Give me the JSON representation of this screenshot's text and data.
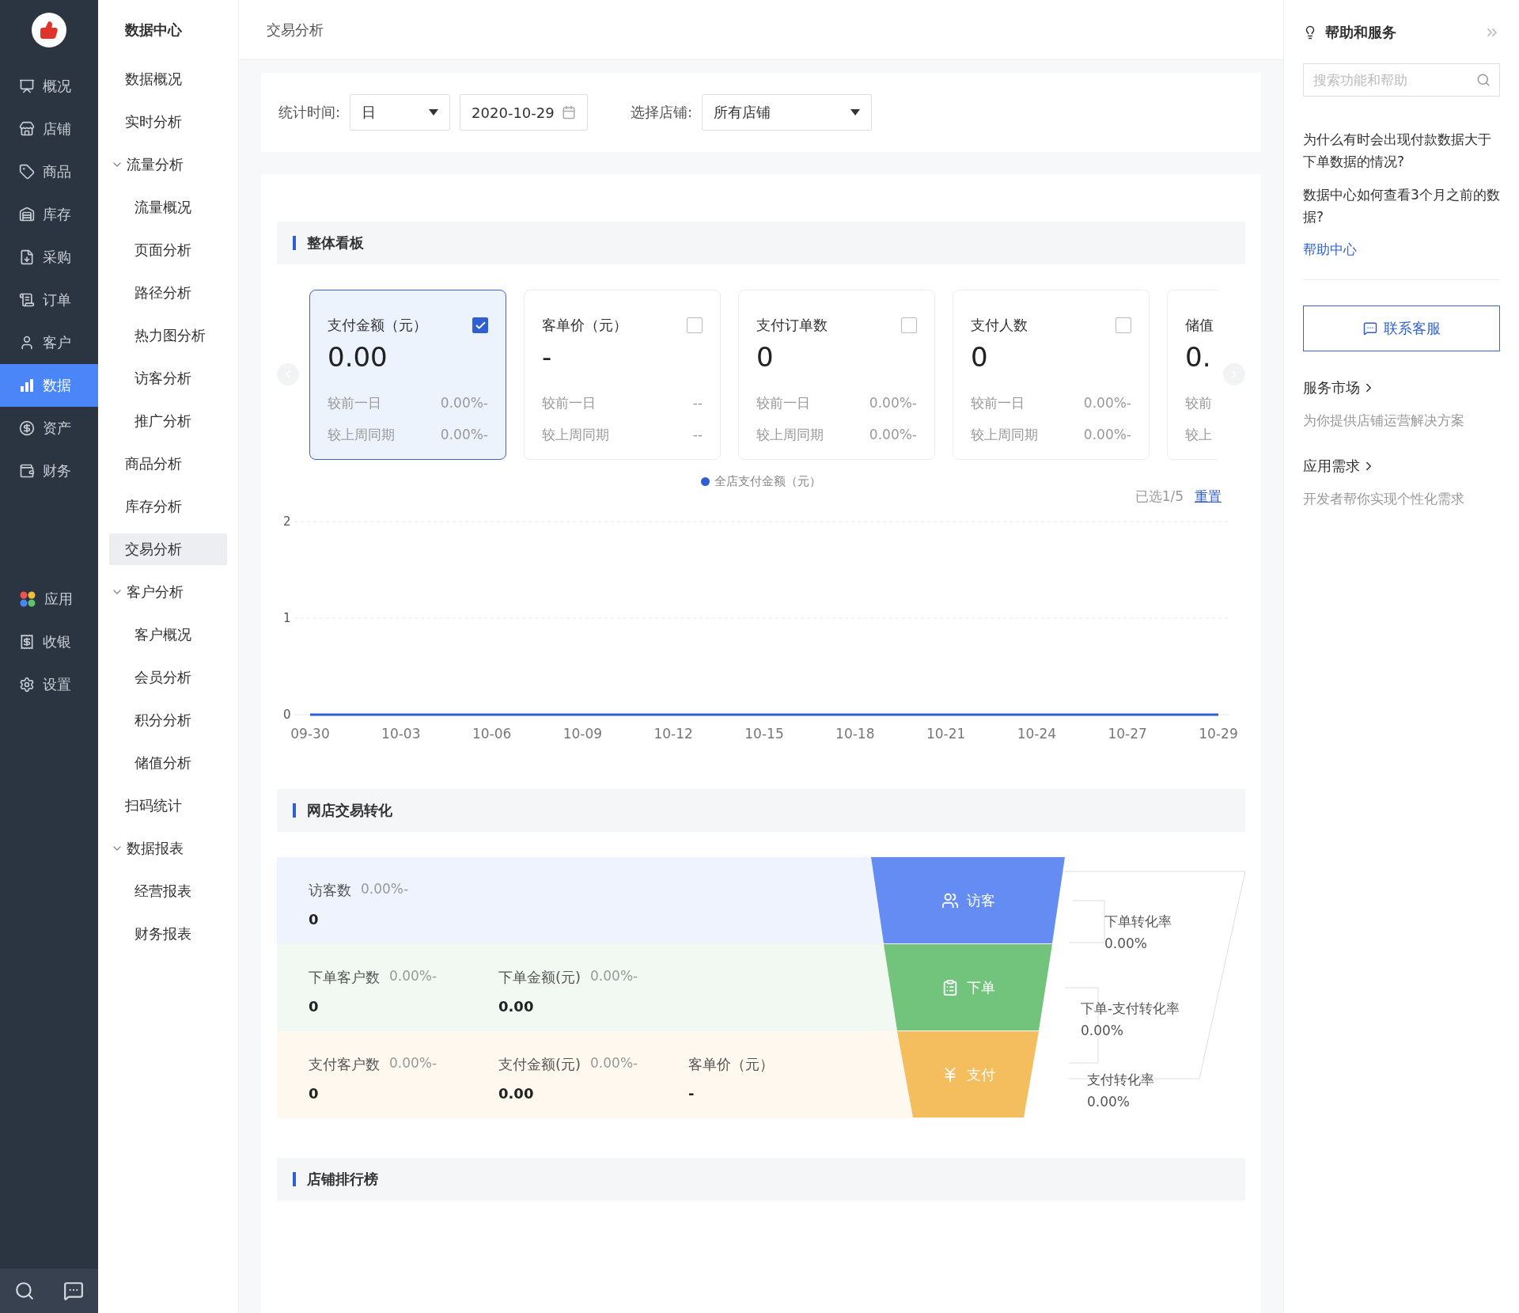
{
  "sidebar": {
    "items": [
      {
        "label": "概况",
        "selected": false
      },
      {
        "label": "店铺",
        "selected": false
      },
      {
        "label": "商品",
        "selected": false
      },
      {
        "label": "库存",
        "selected": false
      },
      {
        "label": "采购",
        "selected": false
      },
      {
        "label": "订单",
        "selected": false
      },
      {
        "label": "客户",
        "selected": false
      },
      {
        "label": "数据",
        "selected": true
      },
      {
        "label": "资产",
        "selected": false
      },
      {
        "label": "财务",
        "selected": false
      }
    ],
    "tool_items": [
      {
        "label": "应用",
        "selected": false
      },
      {
        "label": "收银",
        "selected": false
      },
      {
        "label": "设置",
        "selected": false
      }
    ]
  },
  "subnav": {
    "title": "数据中心",
    "items": [
      {
        "label": "数据概况",
        "selected": false
      },
      {
        "label": "实时分析",
        "selected": false
      },
      {
        "label": "流量分析",
        "selected": false,
        "expanded": true,
        "children": [
          {
            "label": "流量概况",
            "selected": false
          },
          {
            "label": "页面分析",
            "selected": false
          },
          {
            "label": "路径分析",
            "selected": false
          },
          {
            "label": "热力图分析",
            "selected": false
          },
          {
            "label": "访客分析",
            "selected": false
          },
          {
            "label": "推广分析",
            "selected": false
          }
        ]
      },
      {
        "label": "商品分析",
        "selected": false
      },
      {
        "label": "库存分析",
        "selected": false
      },
      {
        "label": "交易分析",
        "selected": true
      },
      {
        "label": "客户分析",
        "selected": false,
        "expanded": true,
        "children": [
          {
            "label": "客户概况",
            "selected": false
          },
          {
            "label": "会员分析",
            "selected": false
          },
          {
            "label": "积分分析",
            "selected": false
          },
          {
            "label": "储值分析",
            "selected": false
          }
        ]
      },
      {
        "label": "扫码统计",
        "selected": false
      },
      {
        "label": "数据报表",
        "selected": false,
        "expanded": true,
        "children": [
          {
            "label": "经营报表",
            "selected": false
          },
          {
            "label": "财务报表",
            "selected": false
          }
        ]
      }
    ]
  },
  "breadcrumb": "交易分析",
  "filters": {
    "time_label": "统计时间:",
    "period": "日",
    "date": "2020-10-29",
    "store_label": "选择店铺:",
    "store": "所有店铺"
  },
  "overview": {
    "title": "整体看板",
    "cards": [
      {
        "title": "支付金额（元）",
        "checked": true,
        "value": "0.00",
        "rows": [
          {
            "label": "较前一日",
            "value": "0.00%-"
          },
          {
            "label": "较上周同期",
            "value": "0.00%-"
          }
        ]
      },
      {
        "title": "客单价（元）",
        "checked": false,
        "value": "-",
        "rows": [
          {
            "label": "较前一日",
            "value": "--"
          },
          {
            "label": "较上周同期",
            "value": "--"
          }
        ]
      },
      {
        "title": "支付订单数",
        "checked": false,
        "value": "0",
        "rows": [
          {
            "label": "较前一日",
            "value": "0.00%-"
          },
          {
            "label": "较上周同期",
            "value": "0.00%-"
          }
        ]
      },
      {
        "title": "支付人数",
        "checked": false,
        "value": "0",
        "rows": [
          {
            "label": "较前一日",
            "value": "0.00%-"
          },
          {
            "label": "较上周同期",
            "value": "0.00%-"
          }
        ]
      },
      {
        "title": "储值",
        "value": "0.",
        "rows": [
          {
            "label": "较前"
          },
          {
            "label": "较上"
          }
        ]
      }
    ],
    "selected_count": "已选1/5",
    "reset": "重置",
    "chart_data": {
      "type": "line",
      "categories": [
        "09-30",
        "10-03",
        "10-06",
        "10-09",
        "10-12",
        "10-15",
        "10-18",
        "10-21",
        "10-24",
        "10-27",
        "10-29"
      ],
      "series": [
        {
          "name": "全店支付金额（元）",
          "color": "#2f5fd0",
          "values": [
            0,
            0,
            0,
            0,
            0,
            0,
            0,
            0,
            0,
            0,
            0
          ]
        }
      ],
      "ylim": [
        0,
        2
      ],
      "yticks": [
        0,
        1,
        2
      ]
    }
  },
  "conversion": {
    "title": "网店交易转化",
    "stages": [
      {
        "label": "访客",
        "color": "#648cf2",
        "metrics": [
          {
            "label": "访客数",
            "change": "0.00%-",
            "value": "0"
          }
        ]
      },
      {
        "label": "下单",
        "color": "#72c47c",
        "metrics": [
          {
            "label": "下单客户数",
            "change": "0.00%-",
            "value": "0"
          },
          {
            "label": "下单金额(元)",
            "change": "0.00%-",
            "value": "0.00"
          }
        ]
      },
      {
        "label": "支付",
        "color": "#f4bd5e",
        "metrics": [
          {
            "label": "支付客户数",
            "change": "0.00%-",
            "value": "0"
          },
          {
            "label": "支付金额(元)",
            "change": "0.00%-",
            "value": "0.00"
          },
          {
            "label": "客单价（元）",
            "value": "-"
          }
        ]
      }
    ],
    "rates": [
      {
        "label": "下单转化率",
        "value": "0.00%"
      },
      {
        "label": "下单-支付转化率",
        "value": "0.00%"
      },
      {
        "label": "支付转化率",
        "value": "0.00%"
      }
    ]
  },
  "ranking": {
    "title": "店铺排行榜"
  },
  "help": {
    "title": "帮助和服务",
    "search": {
      "placeholder": "搜索功能和帮助"
    },
    "questions": [
      "为什么有时会出现付款数据大于下单数据的情况?",
      "数据中心如何查看3个月之前的数据?"
    ],
    "link": "帮助中心",
    "contact": "联系客服",
    "services": [
      {
        "title": "服务市场",
        "desc": "为你提供店铺运营解决方案"
      },
      {
        "title": "应用需求",
        "desc": "开发者帮你实现个性化需求"
      }
    ]
  }
}
